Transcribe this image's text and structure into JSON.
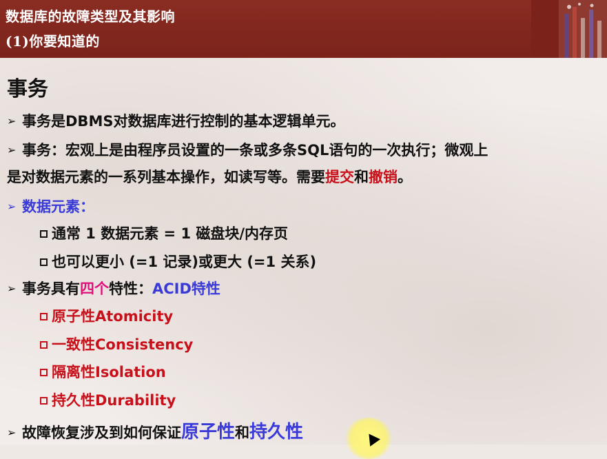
{
  "header": {
    "line1": "数据库的故障类型及其影响",
    "line2": "(1)你要知道的"
  },
  "title": "事务",
  "bullets": {
    "b1": "事务是DBMS对数据库进行控制的基本逻辑单元。",
    "b2_line1": "事务：宏观上是由程序员设置的一条或多条SQL语句的一次执行；微观上",
    "b2_line2_pre": "是对数据元素的一系列基本操作，如读写等。需要",
    "b2_commit": "提交",
    "b2_and": "和",
    "b2_rollback": "撤销",
    "b2_end": "。",
    "b3": "数据元素：",
    "b3_sub1": "通常 1 数据元素 = 1 磁盘块/内存页",
    "b3_sub2": "也可以更小 (=1 记录)或更大 (=1 关系)",
    "b4_pre": "事务具有",
    "b4_four": "四个",
    "b4_mid": "特性：",
    "b4_acid": "ACID特性",
    "acid": [
      "原子性Atomicity",
      "一致性Consistency",
      "隔离性Isolation",
      "持久性Durability"
    ],
    "b5_pre": "故障恢复涉及到如何保证",
    "b5_atom": "原子性",
    "b5_and": "和",
    "b5_dur": "持久性"
  },
  "colors": {
    "header_bg": "#7b231b",
    "red": "#c8101a",
    "magenta": "#e0107a",
    "blue": "#3a3ad8"
  }
}
